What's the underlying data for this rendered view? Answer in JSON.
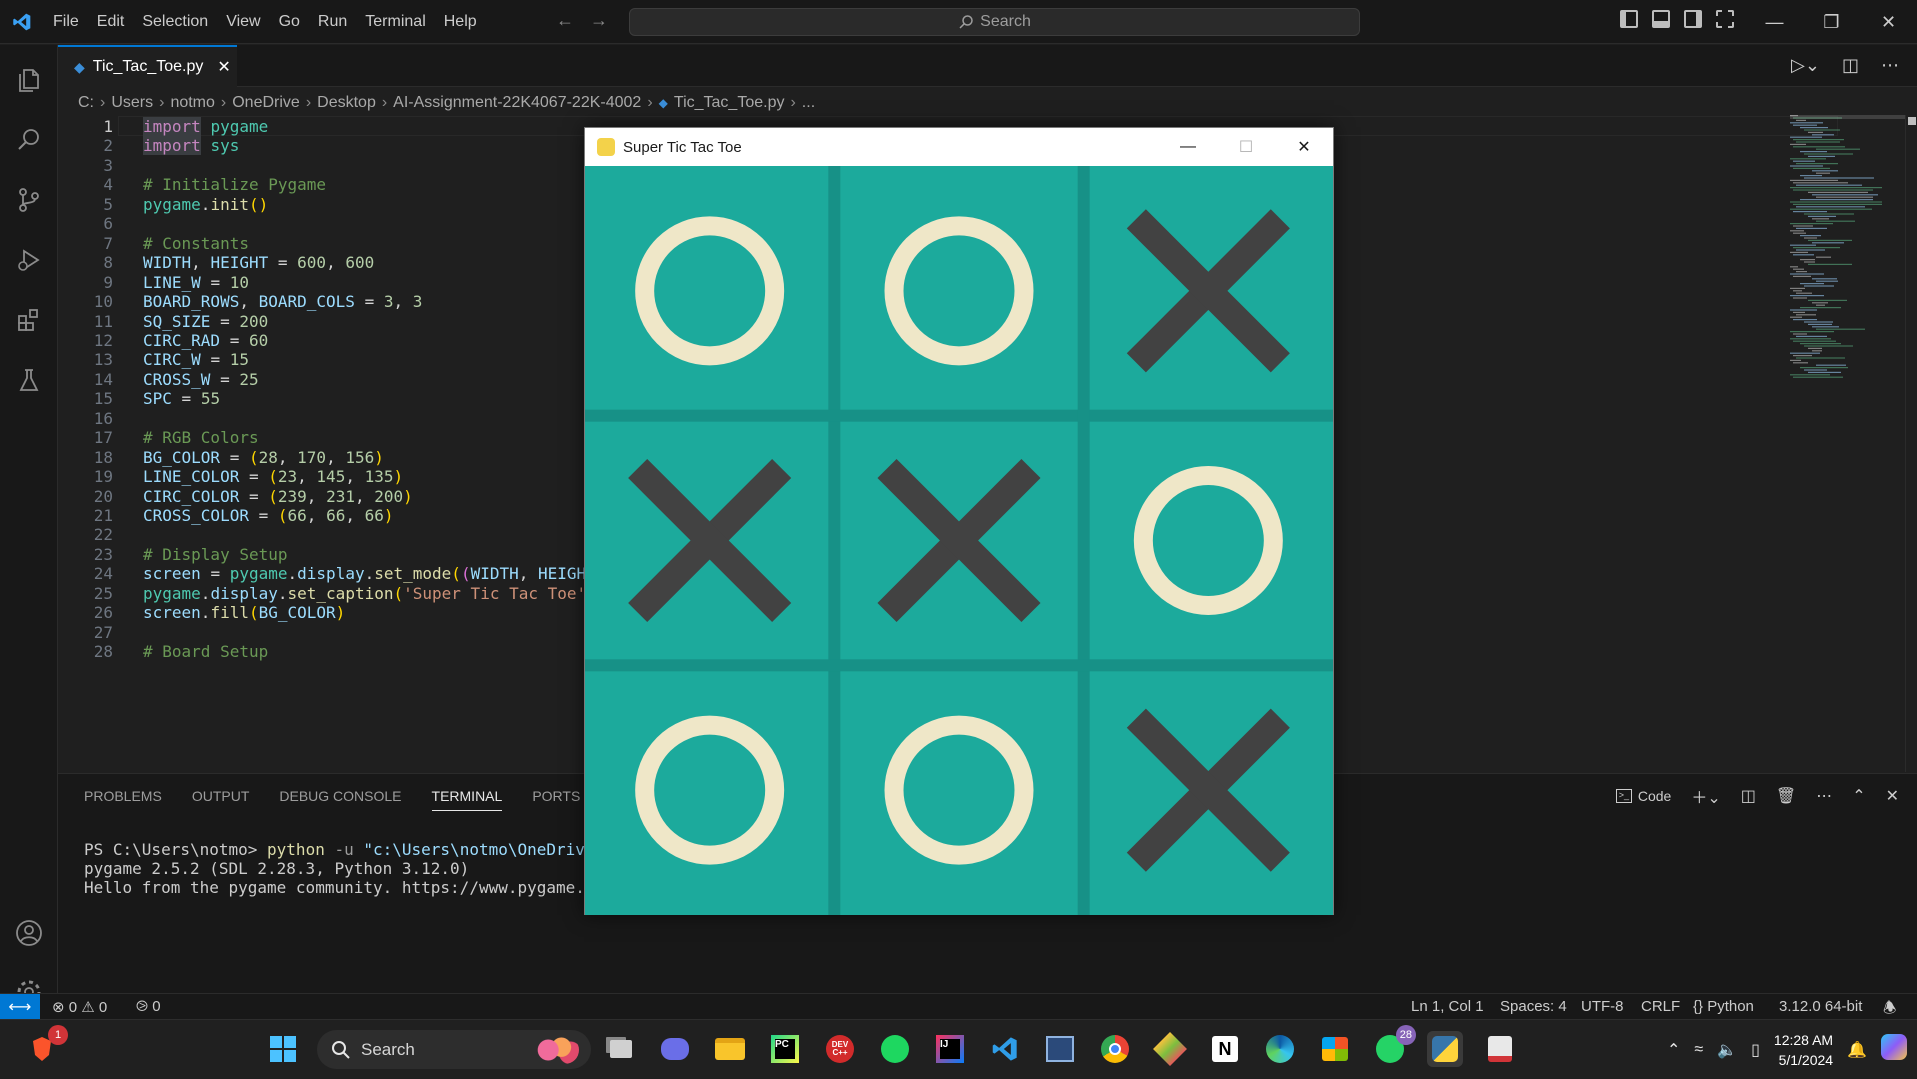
{
  "menu": [
    "File",
    "Edit",
    "Selection",
    "View",
    "Go",
    "Run",
    "Terminal",
    "Help"
  ],
  "search": {
    "placeholder": "Search"
  },
  "tab": {
    "filename": "Tic_Tac_Toe.py"
  },
  "breadcrumb": [
    "C:",
    "Users",
    "notmo",
    "OneDrive",
    "Desktop",
    "AI-Assignment-22K4067-22K-4002",
    "Tic_Tac_Toe.py",
    "..."
  ],
  "code_lines": [
    {
      "n": "1",
      "t": "import pygame"
    },
    {
      "n": "2",
      "t": "import sys"
    },
    {
      "n": "3",
      "t": ""
    },
    {
      "n": "4",
      "t": "# Initialize Pygame"
    },
    {
      "n": "5",
      "t": "pygame.init()"
    },
    {
      "n": "6",
      "t": ""
    },
    {
      "n": "7",
      "t": "# Constants"
    },
    {
      "n": "8",
      "t": "WIDTH, HEIGHT = 600, 600"
    },
    {
      "n": "9",
      "t": "LINE_W = 10"
    },
    {
      "n": "10",
      "t": "BOARD_ROWS, BOARD_COLS = 3, 3"
    },
    {
      "n": "11",
      "t": "SQ_SIZE = 200"
    },
    {
      "n": "12",
      "t": "CIRC_RAD = 60"
    },
    {
      "n": "13",
      "t": "CIRC_W = 15"
    },
    {
      "n": "14",
      "t": "CROSS_W = 25"
    },
    {
      "n": "15",
      "t": "SPC = 55"
    },
    {
      "n": "16",
      "t": ""
    },
    {
      "n": "17",
      "t": "# RGB Colors"
    },
    {
      "n": "18",
      "t": "BG_COLOR = (28, 170, 156)"
    },
    {
      "n": "19",
      "t": "LINE_COLOR = (23, 145, 135)"
    },
    {
      "n": "20",
      "t": "CIRC_COLOR = (239, 231, 200)"
    },
    {
      "n": "21",
      "t": "CROSS_COLOR = (66, 66, 66)"
    },
    {
      "n": "22",
      "t": ""
    },
    {
      "n": "23",
      "t": "# Display Setup"
    },
    {
      "n": "24",
      "t": "screen = pygame.display.set_mode((WIDTH, HEIGH"
    },
    {
      "n": "25",
      "t": "pygame.display.set_caption('Super Tic Tac Toe'"
    },
    {
      "n": "26",
      "t": "screen.fill(BG_COLOR)"
    },
    {
      "n": "27",
      "t": ""
    },
    {
      "n": "28",
      "t": "# Board Setup"
    }
  ],
  "panel": {
    "tabs": [
      "PROBLEMS",
      "OUTPUT",
      "DEBUG CONSOLE",
      "TERMINAL",
      "PORTS"
    ],
    "active_tab": "TERMINAL",
    "shell_label": "Code",
    "terminal": {
      "prompt": "PS C:\\Users\\notmo> ",
      "cmd": "python",
      "flag": " -u ",
      "arg": "\"c:\\Users\\notmo\\OneDrive\\De",
      "line2": "pygame 2.5.2 (SDL 2.28.3, Python 3.12.0)",
      "line3": "Hello from the pygame community. https://www.pygame.org/"
    }
  },
  "statusbar": {
    "errors": "0",
    "warnings": "0",
    "ports": "0",
    "position": "Ln 1, Col 1",
    "spaces": "Spaces: 4",
    "encoding": "UTF-8",
    "eol": "CRLF",
    "language": "Python",
    "interpreter": "3.12.0 64-bit"
  },
  "game_window": {
    "title": "Super Tic Tac Toe",
    "board": [
      [
        "O",
        "O",
        "X"
      ],
      [
        "X",
        "X",
        "O"
      ],
      [
        "O",
        "O",
        "X"
      ]
    ],
    "colors": {
      "bg": "#1caa9c",
      "line": "#179187",
      "circle": "#efe7c8",
      "cross": "#424242"
    }
  },
  "taskbar": {
    "search_label": "Search",
    "time": "12:28 AM",
    "date": "5/1/2024",
    "whatsapp_badge": "28",
    "brave_badge": "1",
    "devcpp_label": "DEV C++"
  },
  "colors": {
    "accent": "#0078d4",
    "editor_bg": "#1f1f1f",
    "chrome_bg": "#181818"
  }
}
